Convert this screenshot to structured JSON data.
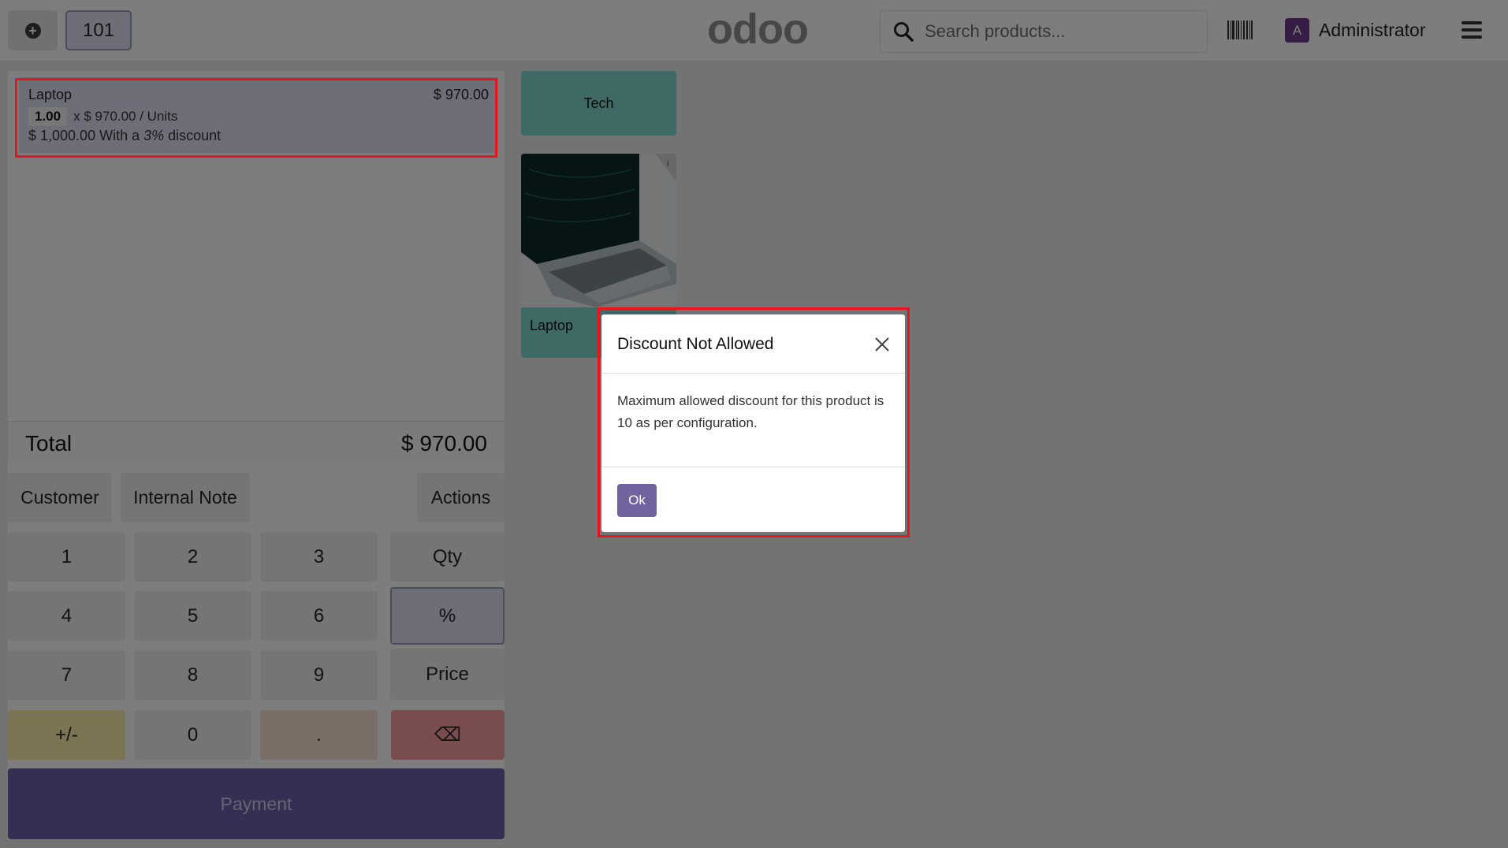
{
  "header": {
    "add_icon": "plus-circle-icon",
    "order_number": "101",
    "logo_text": "odoo",
    "logo_colors": [
      "#8f8f8f",
      "#8f8f8f",
      "#8f8f8f",
      "#8f8f8f"
    ],
    "search_placeholder": "Search products...",
    "user_initial": "A",
    "user_name": "Administrator"
  },
  "order": {
    "line": {
      "product": "Laptop",
      "price": "$ 970.00",
      "qty": "1.00",
      "unit_text": "x $ 970.00 / Units",
      "discount_prefix": "$ 1,000.00 With a ",
      "discount_value": "3%",
      "discount_suffix": " discount"
    },
    "total_label": "Total",
    "total_value": "$ 970.00"
  },
  "controls": {
    "customer": "Customer",
    "internal_note": "Internal Note",
    "actions": "Actions"
  },
  "numpad": {
    "k1": "1",
    "k2": "2",
    "k3": "3",
    "qty": "Qty",
    "k4": "4",
    "k5": "5",
    "k6": "6",
    "percent": "%",
    "k7": "7",
    "k8": "8",
    "k9": "9",
    "price": "Price",
    "plusminus": "+/-",
    "k0": "0",
    "dot": ".",
    "backspace": "⌫"
  },
  "payment_label": "Payment",
  "products": {
    "category": "Tech",
    "items": [
      {
        "name": "Laptop"
      }
    ]
  },
  "modal": {
    "title": "Discount Not Allowed",
    "body": "Maximum allowed discount for this product is 10 as per configuration.",
    "ok_label": "Ok"
  },
  "colors": {
    "accent": "#71639e",
    "category_bg": "#7fd3c8",
    "highlight": "#e8141e"
  }
}
